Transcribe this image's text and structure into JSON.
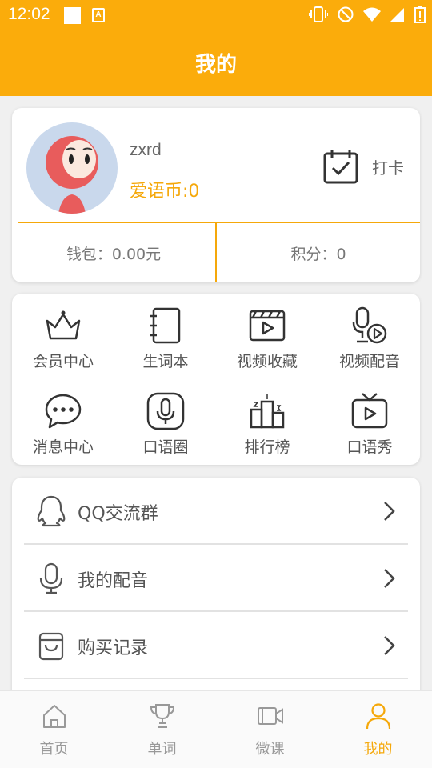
{
  "status_bar": {
    "time": "12:02",
    "a_badge": "A"
  },
  "header": {
    "title": "我的"
  },
  "profile": {
    "username": "zxrd",
    "coins": "爱语币:0",
    "checkin_label": "打卡",
    "wallet": "钱包：0.00元",
    "points": "积分：0"
  },
  "grid": [
    {
      "label": "会员中心",
      "icon": "crown-icon"
    },
    {
      "label": "生词本",
      "icon": "notebook-icon"
    },
    {
      "label": "视频收藏",
      "icon": "video-clapper-icon"
    },
    {
      "label": "视频配音",
      "icon": "mic-play-icon"
    },
    {
      "label": "消息中心",
      "icon": "chat-bubble-icon"
    },
    {
      "label": "口语圈",
      "icon": "mic-circle-icon"
    },
    {
      "label": "排行榜",
      "icon": "podium-icon"
    },
    {
      "label": "口语秀",
      "icon": "tv-play-icon"
    }
  ],
  "list": [
    {
      "label": "QQ交流群",
      "icon": "qq-penguin-icon"
    },
    {
      "label": "我的配音",
      "icon": "microphone-icon"
    },
    {
      "label": "购买记录",
      "icon": "shopping-bag-icon"
    }
  ],
  "bottom_nav": [
    {
      "label": "首页",
      "icon": "home-icon",
      "active": false
    },
    {
      "label": "单词",
      "icon": "trophy-icon",
      "active": false
    },
    {
      "label": "微课",
      "icon": "video-camera-icon",
      "active": false
    },
    {
      "label": "我的",
      "icon": "person-icon",
      "active": true
    }
  ],
  "colors": {
    "accent": "#fbac0b",
    "accent_text": "#f5a80a",
    "background": "#f0f0f0"
  }
}
